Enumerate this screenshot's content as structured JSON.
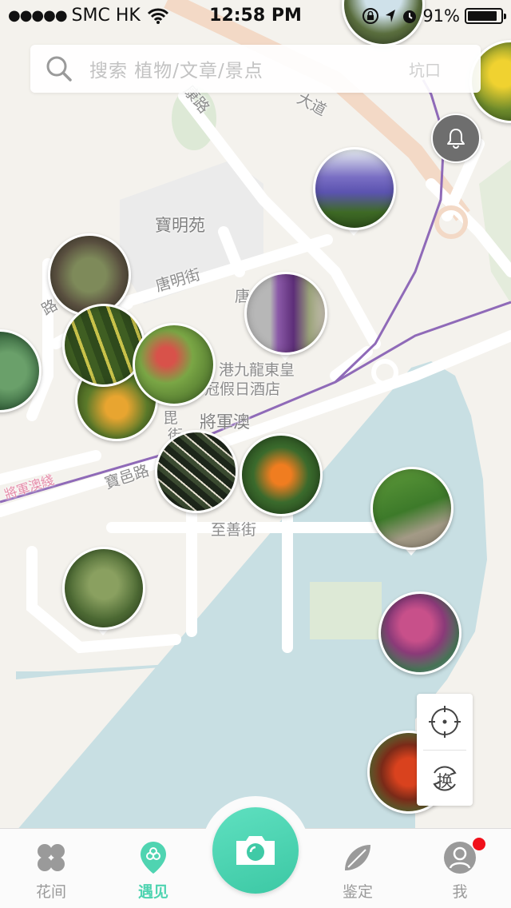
{
  "status_bar": {
    "signal_dots": "●●●●●",
    "carrier": "SMC HK",
    "time": "12:58 PM",
    "battery_text": "91%",
    "battery_level": 0.91
  },
  "search": {
    "placeholder": "搜索   植物/文章/景点",
    "partial_map_text": "坑口"
  },
  "map": {
    "labels": {
      "kang_road": "康路",
      "avenue": "大道",
      "po_ming_court": "寶明苑",
      "tong_ming_street": "唐明街",
      "tong": "唐",
      "lu_left": "路",
      "lu_left2": "路",
      "hotel_line1": "港九龍東皇",
      "hotel_line2": "冠假日酒店",
      "po_street": "毘",
      "po_street2": "街",
      "tseung_kwan_o": "將軍澳",
      "po_yap_road": "寶邑路",
      "chi_shin_street": "至善街",
      "mtr_line": "將軍澳綫"
    },
    "colors": {
      "water": "#c8dfe3",
      "green": "#dde9d6",
      "road": "#ffffff",
      "mtr": "#8f6ab8",
      "major_road": "#f3d9c6"
    }
  },
  "pins": [
    {
      "name": "top-tree"
    },
    {
      "name": "yellow-flowers"
    },
    {
      "name": "purple-lupins"
    },
    {
      "name": "grass-weeds"
    },
    {
      "name": "purple-oxalis"
    },
    {
      "name": "left-edge-leaves"
    },
    {
      "name": "snake-plant"
    },
    {
      "name": "red-tip-shrub"
    },
    {
      "name": "yellow-bracts"
    },
    {
      "name": "dark-leaf-plant"
    },
    {
      "name": "bird-of-paradise"
    },
    {
      "name": "paving-weed"
    },
    {
      "name": "palm-shrub"
    },
    {
      "name": "crape-myrtle"
    },
    {
      "name": "red-bean-pods"
    }
  ],
  "controls": {
    "switch_label": "换"
  },
  "tabs": [
    {
      "label": "花间"
    },
    {
      "label": "遇见"
    },
    {
      "label": "鉴定"
    },
    {
      "label": "我"
    }
  ]
}
